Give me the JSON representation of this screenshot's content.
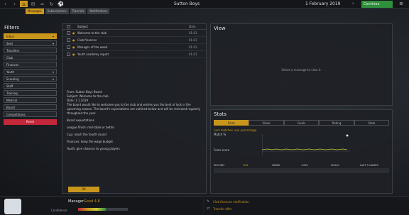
{
  "topbar": {
    "club_name": "Sutton Boys",
    "date": "1 February 2019",
    "continue_label": "Continue",
    "icons": [
      "back-icon",
      "forward-icon",
      "home-icon",
      "inbox-icon",
      "link-icon",
      "refresh-icon",
      "soccer-icon"
    ]
  },
  "subnav": {
    "tabs": [
      "Messages",
      "Subscriptions",
      "Tutorials",
      "Notifications"
    ]
  },
  "filters": {
    "title": "Filters",
    "items": [
      {
        "label": "Inbox",
        "selected": true,
        "chevron": true
      },
      {
        "label": "Sent",
        "selected": false,
        "chevron": true
      },
      {
        "label": "Transfers",
        "selected": false,
        "chevron": false
      },
      {
        "label": "Club",
        "selected": false,
        "chevron": false
      },
      {
        "label": "Finances",
        "selected": false,
        "chevron": false
      },
      {
        "label": "Youth",
        "selected": false,
        "chevron": true
      },
      {
        "label": "Scouting",
        "selected": false,
        "chevron": true
      },
      {
        "label": "Staff",
        "selected": false,
        "chevron": false
      },
      {
        "label": "Training",
        "selected": false,
        "chevron": false
      },
      {
        "label": "Medical",
        "selected": false,
        "chevron": false
      },
      {
        "label": "Board",
        "selected": false,
        "chevron": false
      },
      {
        "label": "Competitions",
        "selected": false,
        "chevron": false
      }
    ],
    "reset_label": "Reset"
  },
  "messages": {
    "col_subject": "Subject",
    "col_date": "Date",
    "rows": [
      {
        "subject": "Welcome to the club",
        "date": "01.01"
      },
      {
        "subject": "Club finances",
        "date": "01.01"
      },
      {
        "subject": "Manager of the week",
        "date": "01.01"
      },
      {
        "subject": "Youth academy report",
        "date": "01.01"
      }
    ],
    "body": [
      "From: Sutton Boys Board",
      "Subject: Welcome to the club",
      "Date: 1.1.2019",
      "The board would like to welcome you to the club and wishes you the best of luck in the upcoming season. The board's expectations are outlined below and will be reviewed regularly throughout the year.",
      "Board expectations",
      "League finish: mid-table or better",
      "Cup: reach the fourth round",
      "Finances: keep the wage budget",
      "Youth: give chances to young players"
    ],
    "ok_label": "OK"
  },
  "view": {
    "title": "View",
    "empty_text": "Select a message to view it."
  },
  "stats": {
    "title": "Stats",
    "tabs": [
      "Form",
      "Value",
      "Goals",
      "Rating",
      "Stats"
    ],
    "legend": "Last matches: win percentage",
    "sub1": "Match %",
    "sub2": "Form score",
    "table_headers": [
      "RECORD",
      "WIN",
      "DRAW",
      "LOSS",
      "GOALS",
      "LAST 5 GAMES"
    ]
  },
  "bottom": {
    "coach_name": "Manager",
    "coach_rating": "Good 4.8",
    "bar_label": "Confidence",
    "bar_fill_fraction": 0.55,
    "notifications": [
      {
        "text": "Club finances notification",
        "color": "#c9961c"
      },
      {
        "text": "Transfer offer",
        "color": "#c9961c"
      }
    ]
  },
  "colors": {
    "accent": "#c9961c",
    "danger": "#c3283a",
    "success": "#2f8f3b"
  }
}
